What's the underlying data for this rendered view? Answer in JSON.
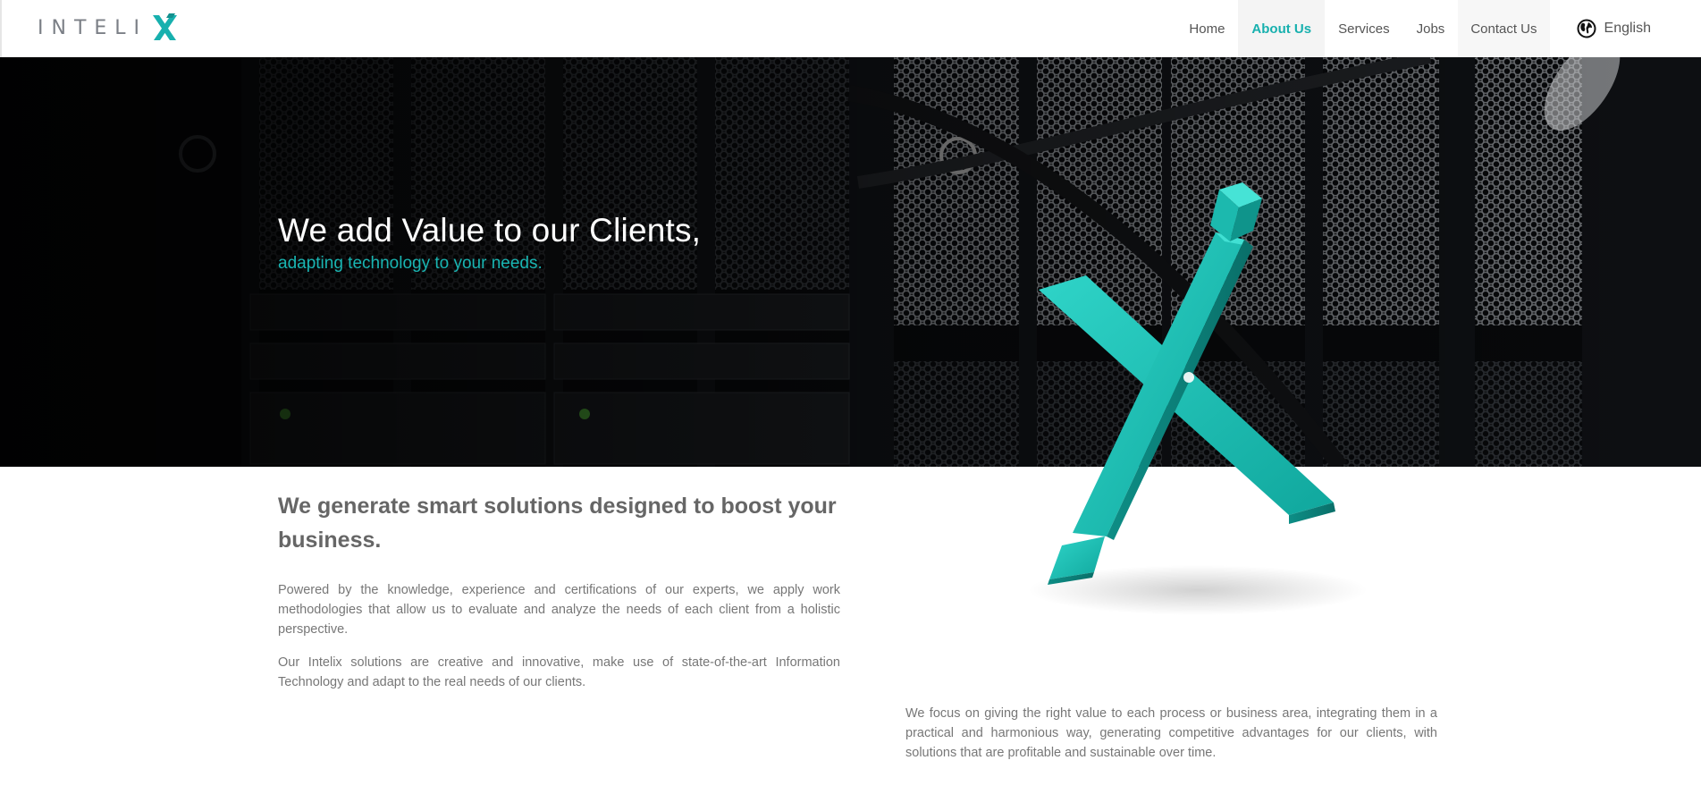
{
  "header": {
    "logo_text": "INTELI",
    "nav": [
      {
        "label": "Home"
      },
      {
        "label": "About Us"
      },
      {
        "label": "Services"
      },
      {
        "label": "Jobs"
      },
      {
        "label": "Contact Us"
      }
    ],
    "language": "English"
  },
  "hero": {
    "title": "We add Value to our Clients,",
    "subtitle": "adapting technology to your needs."
  },
  "content": {
    "headline": "We generate smart solutions designed to boost your business.",
    "paragraph_1": "Powered by the knowledge, experience and certifications of our experts, we apply work methodologies that allow us to evaluate and analyze the needs of each client from a holistic perspective.",
    "paragraph_2": "Our Intelix solutions are creative and innovative, make use of state-of-the-art Information Technology and adapt to the real needs of our clients.",
    "paragraph_3": "We focus on giving the right value to each process or business area, integrating them in a practical and harmonious way, generating competitive advantages for our clients, with solutions that are profitable and sustainable over time."
  },
  "colors": {
    "accent": "#17b0ae",
    "hero_background": "#060708",
    "text": "#666666"
  },
  "icons": {
    "language": "globe-icon",
    "brand": "intelix-x-logo"
  }
}
